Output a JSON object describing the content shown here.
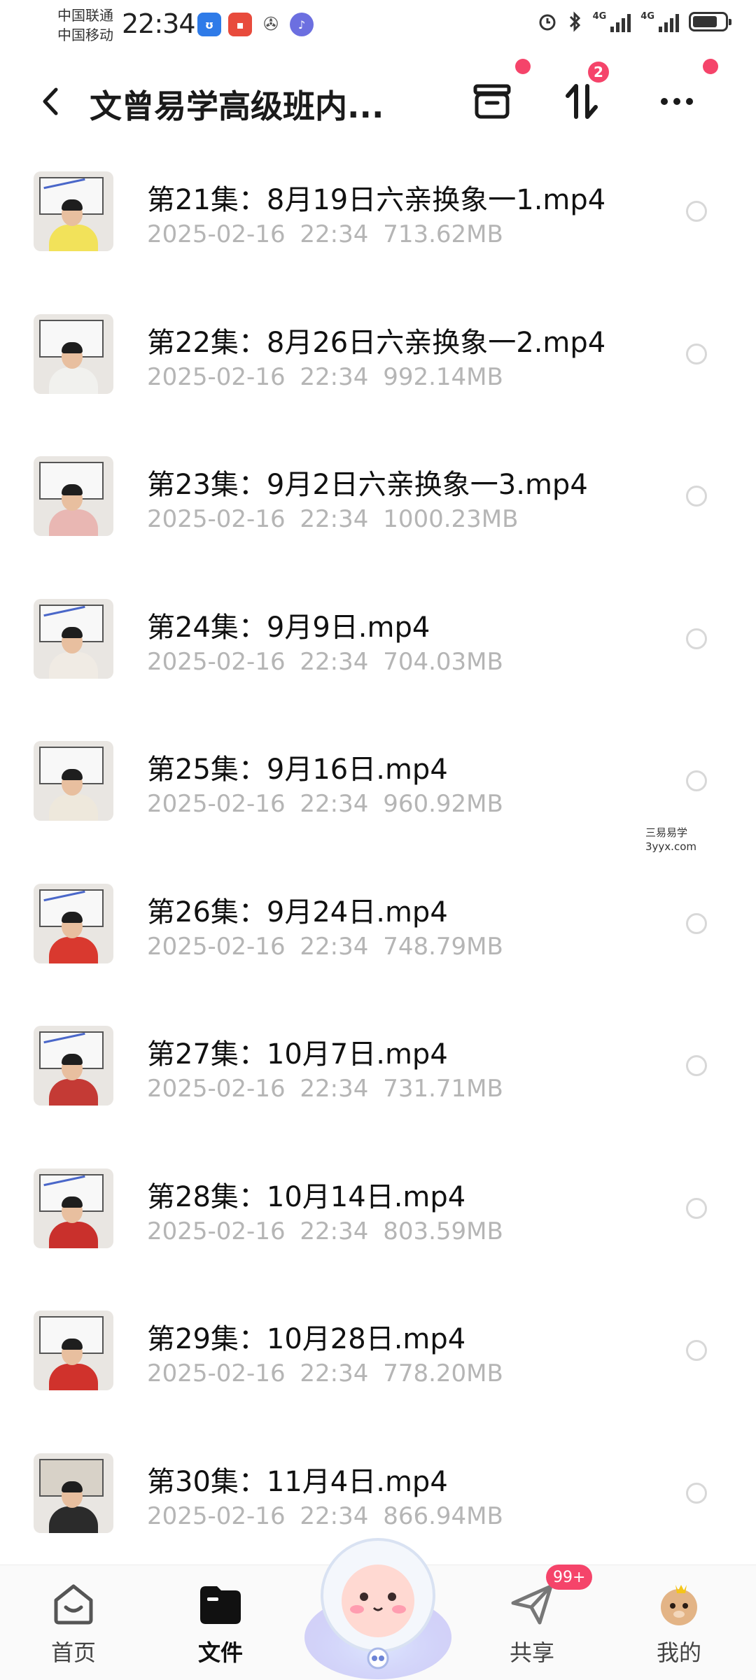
{
  "status_bar": {
    "carrier_1": "中国联通",
    "carrier_2": "中国移动",
    "time": "22:34",
    "network_1": "4G",
    "network_2": "4G"
  },
  "header": {
    "title": "文曾易学高级班内...",
    "transfer_badge": "2"
  },
  "files": [
    {
      "name": "第21集：8月19日六亲换象一1.mp4",
      "date": "2025-02-16",
      "time": "22:34",
      "size": "713.62MB",
      "shirt": "#f2e25a"
    },
    {
      "name": "第22集：8月26日六亲换象一2.mp4",
      "date": "2025-02-16",
      "time": "22:34",
      "size": "992.14MB",
      "shirt": "#f1f1ee"
    },
    {
      "name": "第23集：9月2日六亲换象一3.mp4",
      "date": "2025-02-16",
      "time": "22:34",
      "size": "1000.23MB",
      "shirt": "#e9b7b3"
    },
    {
      "name": "第24集：9月9日.mp4",
      "date": "2025-02-16",
      "time": "22:34",
      "size": "704.03MB",
      "shirt": "#f0ebe4"
    },
    {
      "name": "第25集：9月16日.mp4",
      "date": "2025-02-16",
      "time": "22:34",
      "size": "960.92MB",
      "shirt": "#eee8dc"
    },
    {
      "name": "第26集：9月24日.mp4",
      "date": "2025-02-16",
      "time": "22:34",
      "size": "748.79MB",
      "shirt": "#d9392f"
    },
    {
      "name": "第27集：10月7日.mp4",
      "date": "2025-02-16",
      "time": "22:34",
      "size": "731.71MB",
      "shirt": "#c43a35"
    },
    {
      "name": "第28集：10月14日.mp4",
      "date": "2025-02-16",
      "time": "22:34",
      "size": "803.59MB",
      "shirt": "#c9302c"
    },
    {
      "name": "第29集：10月28日.mp4",
      "date": "2025-02-16",
      "time": "22:34",
      "size": "778.20MB",
      "shirt": "#d0322c"
    },
    {
      "name": "第30集：11月4日.mp4",
      "date": "2025-02-16",
      "time": "22:34",
      "size": "866.94MB",
      "shirt": "#2b2b2b"
    }
  ],
  "watermark": {
    "line1": "三易易学",
    "line2": "3yyx.com"
  },
  "nav": {
    "home": "首页",
    "files": "文件",
    "share": "共享",
    "share_badge": "99+",
    "mine": "我的"
  },
  "colors": {
    "accent_badge": "#f5446a",
    "meta_text": "#b5b5b5",
    "nav_active": "#111111"
  }
}
